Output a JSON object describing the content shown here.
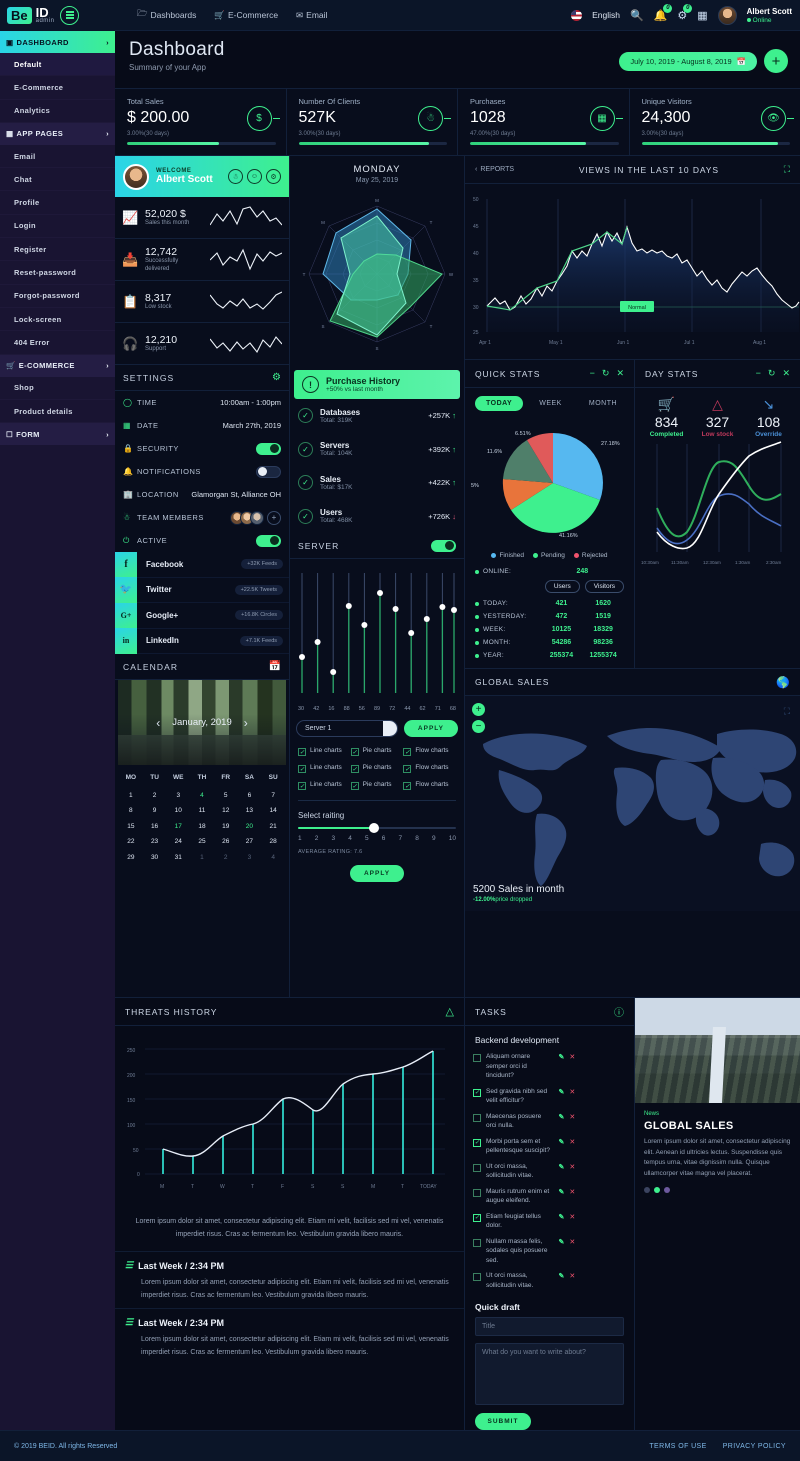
{
  "brand": {
    "logo_be": "Be",
    "logo_id": "ID",
    "logo_sub": "admin"
  },
  "topnav": [
    {
      "label": "Dashboards",
      "icon": "folder-icon"
    },
    {
      "label": "E-Commerce",
      "icon": "cart-icon"
    },
    {
      "label": "Email",
      "icon": "mail-icon"
    }
  ],
  "topright": {
    "language": "English",
    "search_icon": "search-icon",
    "bell_badge": "0",
    "alert_badge": "0",
    "grid_icon": "grid-icon",
    "user_name": "Albert Scott",
    "user_status": "Online"
  },
  "sidebar": {
    "groups": [
      {
        "label": "DASHBOARD",
        "icon": "dashboard-icon",
        "active": true,
        "items": [
          "Default",
          "E-Commerce",
          "Analytics"
        ]
      },
      {
        "label": "APP PAGES",
        "icon": "pages-icon",
        "active": false,
        "items": [
          "Email",
          "Chat",
          "Profile",
          "Login",
          "Register",
          "Reset-password",
          "Forgot-password",
          "Lock-screen",
          "404 Error"
        ]
      },
      {
        "label": "E-COMMERCE",
        "icon": "cart-icon",
        "active": false,
        "items": [
          "Shop",
          "Product details"
        ]
      },
      {
        "label": "FORM",
        "icon": "form-icon",
        "active": false,
        "items": []
      }
    ],
    "selected_item": "Default"
  },
  "page": {
    "title": "Dashboard",
    "subtitle": "Summary of your App",
    "date_range": "July 10, 2019 - August 8, 2019",
    "add_button": "+"
  },
  "kpis": [
    {
      "title": "Total Sales",
      "value": "$ 200.00",
      "change": "3.00%(30 days)",
      "progress": 62,
      "icon": "dollar-icon"
    },
    {
      "title": "Number Of Clients",
      "value": "527K",
      "change": "3.00%(30 days)",
      "progress": 88,
      "icon": "user-icon"
    },
    {
      "title": "Purchases",
      "value": "1028",
      "change": "47.00%(30 days)",
      "progress": 78,
      "icon": "calculator-icon"
    },
    {
      "title": "Unique Visitors",
      "value": "24,300",
      "change": "3.00%(30 days)",
      "progress": 92,
      "icon": "eye-icon"
    }
  ],
  "welcome": {
    "greeting": "WELCOME",
    "name": "Albert Scott",
    "icons": [
      "user-icon",
      "chat-icon",
      "gear-icon"
    ]
  },
  "mini_stats": [
    {
      "value": "52,020 $",
      "label": "Sales this month",
      "icon": "chart-bar-icon"
    },
    {
      "value": "12,742",
      "label": "Successfully delivered",
      "icon": "inbox-icon"
    },
    {
      "value": "8,317",
      "label": "Low stock",
      "icon": "clipboard-icon"
    },
    {
      "value": "12,210",
      "label": "Support",
      "icon": "headset-icon"
    }
  ],
  "settings": {
    "title": "SETTINGS",
    "gear_icon": "gear-icon",
    "rows": [
      {
        "label": "TIME",
        "value": "10:00am - 1:00pm",
        "icon": "clock-icon",
        "type": "text"
      },
      {
        "label": "DATE",
        "value": "March 27th, 2019",
        "icon": "calendar-icon",
        "type": "text"
      },
      {
        "label": "SECURITY",
        "value": "on",
        "icon": "lock-icon",
        "type": "toggle"
      },
      {
        "label": "NOTIFICATIONS",
        "value": "off",
        "icon": "bell-icon",
        "type": "toggle"
      },
      {
        "label": "LOCATION",
        "value": "Glamorgan St, Alliance OH",
        "icon": "building-icon",
        "type": "text"
      },
      {
        "label": "TEAM MEMBERS",
        "value": "",
        "icon": "team-icon",
        "type": "avatars"
      },
      {
        "label": "ACTIVE",
        "value": "on",
        "icon": "power-icon",
        "type": "toggle"
      }
    ]
  },
  "social": [
    {
      "name": "Facebook",
      "glyph": "f",
      "meta": "+32K Feeds"
    },
    {
      "name": "Twitter",
      "glyph": "t",
      "meta": "+22.5K Tweets"
    },
    {
      "name": "Google+",
      "glyph": "G+",
      "meta": "+16.8K Circles"
    },
    {
      "name": "LinkedIn",
      "glyph": "in",
      "meta": "+7.1K Feeds"
    }
  ],
  "calendar": {
    "title": "CALENDAR",
    "icon": "calendar-icon",
    "month": "January, 2019",
    "prev": "‹",
    "next": "›",
    "weekdays": [
      "MO",
      "TU",
      "WE",
      "TH",
      "FR",
      "SA",
      "SU"
    ],
    "days": [
      {
        "d": "1"
      },
      {
        "d": "2"
      },
      {
        "d": "3"
      },
      {
        "d": "4",
        "mark": true
      },
      {
        "d": "5"
      },
      {
        "d": "6"
      },
      {
        "d": "7"
      },
      {
        "d": "8"
      },
      {
        "d": "9"
      },
      {
        "d": "10"
      },
      {
        "d": "11"
      },
      {
        "d": "12"
      },
      {
        "d": "13"
      },
      {
        "d": "14"
      },
      {
        "d": "15"
      },
      {
        "d": "16"
      },
      {
        "d": "17",
        "mark": true
      },
      {
        "d": "18"
      },
      {
        "d": "19"
      },
      {
        "d": "20",
        "mark": true
      },
      {
        "d": "21"
      },
      {
        "d": "22"
      },
      {
        "d": "23"
      },
      {
        "d": "24"
      },
      {
        "d": "25"
      },
      {
        "d": "26"
      },
      {
        "d": "27"
      },
      {
        "d": "28"
      },
      {
        "d": "29"
      },
      {
        "d": "30"
      },
      {
        "d": "31"
      },
      {
        "d": "1",
        "mut": true
      },
      {
        "d": "2",
        "mut": true
      },
      {
        "d": "3",
        "mut": true
      },
      {
        "d": "4",
        "mut": true
      }
    ]
  },
  "radar": {
    "day": "MONDAY",
    "date": "May 25, 2019",
    "axes": [
      "M",
      "T",
      "W",
      "T",
      "F",
      "S",
      "S",
      "M"
    ],
    "series": [
      {
        "name": "series-blue",
        "color": "#2e7fb8",
        "values": [
          0.95,
          0.72,
          0.45,
          0.62,
          0.38,
          0.55,
          0.8,
          0.85
        ]
      },
      {
        "name": "series-green",
        "color": "#2f9e5e",
        "values": [
          0.3,
          0.4,
          0.95,
          0.7,
          0.92,
          0.5,
          0.35,
          0.28
        ]
      },
      {
        "name": "series-teal",
        "color": "#4fe3b0",
        "values": [
          0.85,
          0.55,
          0.3,
          0.6,
          0.9,
          0.85,
          0.4,
          0.75
        ]
      }
    ]
  },
  "purchase_history": {
    "title": "Purchase History",
    "subtitle": "+50% vs last month",
    "icon": "alert-icon",
    "rows": [
      {
        "name": "Databases",
        "total": "Total: 319K",
        "delta": "+257K",
        "dir": "up"
      },
      {
        "name": "Servers",
        "total": "Total: 104K",
        "delta": "+392K",
        "dir": "up"
      },
      {
        "name": "Sales",
        "total": "Total: $17K",
        "delta": "+422K",
        "dir": "up"
      },
      {
        "name": "Users",
        "total": "Total: 468K",
        "delta": "+726K",
        "dir": "down"
      }
    ]
  },
  "server": {
    "title": "SERVER",
    "toggle": "on",
    "values": [
      30,
      42,
      16,
      88,
      56,
      89,
      72,
      44,
      62,
      71,
      68
    ],
    "select_value": "Server 1",
    "apply_label": "APPLY",
    "checkboxes": [
      "Line charts",
      "Pie charts",
      "Flow charts",
      "Line charts",
      "Pie charts",
      "Flow charts",
      "Line charts",
      "Pie charts",
      "Flow charts"
    ],
    "rating_label": "Select raiting",
    "rating_scale": [
      "1",
      "2",
      "3",
      "4",
      "5",
      "6",
      "7",
      "8",
      "9",
      "10"
    ],
    "rating_value": 5,
    "average_label": "AVERAGE RATING: 7.6",
    "apply2_label": "APPLY"
  },
  "views_panel": {
    "reports_label": "REPORTS",
    "title": "VIEWS IN THE LAST 10 DAYS",
    "expand_icon": "expand-icon"
  },
  "quick_stats": {
    "title": "QUICK STATS",
    "controls": [
      "minimize-icon",
      "refresh-icon",
      "close-icon"
    ],
    "tabs": [
      "TODAY",
      "WEEK",
      "MONTH"
    ],
    "active_tab": "TODAY",
    "labels": {
      "l1": "6.51%",
      "l2": "27.18%",
      "l3": "11.6%",
      "l4": "5%",
      "l5": "41.16%"
    },
    "legend": [
      {
        "name": "Finished",
        "color": "#56b8f0"
      },
      {
        "name": "Pending",
        "color": "#3ef08e"
      },
      {
        "name": "Rejected",
        "color": "#f0536d"
      }
    ],
    "online_label": "ONLINE:",
    "online_value": "248",
    "col_users": "Users",
    "col_visitors": "Visitors",
    "rows": [
      {
        "label": "TODAY:",
        "users": "421",
        "visitors": "1620"
      },
      {
        "label": "YESTERDAY:",
        "users": "472",
        "visitors": "1519"
      },
      {
        "label": "WEEK:",
        "users": "10125",
        "visitors": "18329"
      },
      {
        "label": "MONTH:",
        "users": "54286",
        "visitors": "98236"
      },
      {
        "label": "YEAR:",
        "users": "255374",
        "visitors": "1255374"
      }
    ]
  },
  "day_stats": {
    "title": "DAY STATS",
    "controls": [
      "minimize-icon",
      "refresh-icon",
      "close-icon"
    ],
    "cards": [
      {
        "value": "834",
        "label": "Completed",
        "icon": "basket-icon",
        "color": "#3ef08e"
      },
      {
        "value": "327",
        "label": "Low stock",
        "icon": "warning-icon",
        "color": "#c0395c"
      },
      {
        "value": "108",
        "label": "Override",
        "icon": "arrow-down-icon",
        "color": "#4a8fd6"
      }
    ],
    "xlabels": [
      "10:30am",
      "11:30am",
      "12:30am",
      "1:30am",
      "2:30am"
    ]
  },
  "global_sales": {
    "title": "GLOBAL SALES",
    "globe_icon": "globe-icon",
    "zoom_in": "+",
    "zoom_out": "−",
    "expand_icon": "expand-icon",
    "summary": "5200 Sales in month",
    "delta": "-12.00%",
    "delta_note": "price dropped"
  },
  "threats": {
    "title": "THREATS HISTORY",
    "icon": "warning-icon",
    "note": "Lorem ipsum dolor sit amet, consectetur adipiscing elit. Etiam mi velit, facilisis sed mi vel, venenatis imperdiet risus. Cras ac fermentum leo. Vestibulum gravida libero mauris.",
    "entries": [
      {
        "title": "Last Week / 2:34 PM",
        "body": "Lorem ipsum dolor sit amet, consectetur adipiscing elit. Etiam mi velit, facilisis sed mi vel, venenatis imperdiet risus. Cras ac fermentum leo. Vestibulum gravida libero mauris."
      },
      {
        "title": "Last Week / 2:34 PM",
        "body": "Lorem ipsum dolor sit amet, consectetur adipiscing elit. Etiam mi velit, facilisis sed mi vel, venenatis imperdiet risus. Cras ac fermentum leo. Vestibulum gravida libero mauris."
      }
    ]
  },
  "tasks": {
    "title": "TASKS",
    "help_icon": "help-icon",
    "group": "Backend development",
    "items": [
      {
        "text": "Aliquam ornare semper orci id tincidunt?",
        "done": false
      },
      {
        "text": "Sed gravida nibh sed velit efficitur?",
        "done": true
      },
      {
        "text": "Maecenas posuere orci nulla.",
        "done": false
      },
      {
        "text": "Morbi porta sem et pellentesque suscipit?",
        "done": true
      },
      {
        "text": "Ut orci massa, sollicitudin vitae.",
        "done": false
      },
      {
        "text": "Mauris rutrum enim et augue eleifend.",
        "done": false
      },
      {
        "text": "Etiam feugiat tellus dolor.",
        "done": true
      },
      {
        "text": "Nullam massa felis, sodales quis posuere sed.",
        "done": false
      },
      {
        "text": "Ut orci massa, sollicitudin vitae.",
        "done": false
      }
    ],
    "draft_title": "Quick draft",
    "draft_title_ph": "Title",
    "draft_body_ph": "What do you want to write about?",
    "submit_label": "SUBMIT"
  },
  "news": {
    "kicker": "News",
    "headline": "GLOBAL SALES",
    "body": "Lorem ipsum dolor sit amet, consectetur adipiscing elit. Aenean id ultricies lectus. Suspendisse quis tempus urna, vitae dignissim nulla. Quisque ullamcorper vitae magna vel placerat."
  },
  "footer": {
    "copyright": "© 2019 BEID. All rights Reserved",
    "links": [
      "TERMS OF USE",
      "PRIVACY POLICY"
    ]
  },
  "chart_data": [
    {
      "type": "area",
      "name": "views-last-10-days",
      "title": "VIEWS IN THE LAST 10 DAYS",
      "xlabel": "",
      "ylabel": "",
      "ylim": [
        25,
        50
      ],
      "yticks": [
        25,
        30,
        35,
        40,
        45,
        50
      ],
      "xticks": [
        "Apr 1",
        "May 1",
        "Jun 1",
        "Jul 1",
        "Aug 1"
      ],
      "annotation": "Normal",
      "annotation_y": 30,
      "grid": true,
      "series": [
        {
          "name": "views",
          "color": "#ffffff",
          "values": [
            31,
            32,
            33,
            31.5,
            32,
            30.8,
            31.2,
            33,
            31.6,
            32.4,
            34.5,
            33,
            35,
            34,
            36.5,
            38,
            40,
            43,
            41.5,
            43,
            42,
            44.5,
            46.5,
            44,
            47,
            45,
            46.8,
            44.5,
            48,
            45,
            43.5,
            44,
            43,
            44.2,
            43.5,
            44,
            43,
            42.5,
            43.5,
            41.8,
            42.6,
            40.5,
            39,
            40,
            38.2,
            37,
            38,
            36.5,
            35.5,
            37,
            38.5,
            40,
            39,
            40.5,
            41.2,
            39.5,
            38,
            37,
            36,
            34,
            33.5,
            32,
            31.5,
            31,
            30.5,
            30.8,
            31.5,
            30.2,
            29.8,
            30.4,
            29.5,
            29,
            28.6,
            29.2,
            28,
            27.5,
            26.8,
            28.5,
            30.5,
            31.8
          ]
        }
      ]
    },
    {
      "type": "pie",
      "name": "quick-stats-pie",
      "title": "QUICK STATS",
      "labels": [
        "Finished",
        "Pending",
        "Rejected",
        "Pending-alt",
        "Rejected-alt"
      ],
      "values": [
        27.18,
        41.16,
        5,
        11.6,
        6.51
      ],
      "colors": [
        "#56b8f0",
        "#3ef08e",
        "#e8743b",
        "#4f7f6a",
        "#e05a5a"
      ],
      "legend": [
        "Finished",
        "Pending",
        "Rejected"
      ],
      "legend_position": "bottom"
    },
    {
      "type": "line",
      "name": "day-stats-lines",
      "title": "DAY STATS",
      "x": [
        "10:30am",
        "11:30am",
        "12:30am",
        "1:30am",
        "2:30am"
      ],
      "ylim": [
        0,
        100
      ],
      "grid": true,
      "series": [
        {
          "name": "completed",
          "color": "#2fae5c",
          "values": [
            48,
            18,
            72,
            92,
            62
          ]
        },
        {
          "name": "override",
          "color": "#4a6fc4",
          "values": [
            28,
            8,
            40,
            60,
            22
          ]
        },
        {
          "name": "low-stock",
          "color": "#ffffff",
          "values": [
            22,
            2,
            42,
            78,
            100
          ]
        }
      ]
    },
    {
      "type": "bar",
      "name": "threats-history",
      "title": "THREATS HISTORY",
      "categories": [
        "M",
        "T",
        "W",
        "T",
        "F",
        "S",
        "S",
        "M",
        "T",
        "TODAY"
      ],
      "values": [
        50,
        35,
        75,
        100,
        150,
        128,
        180,
        200,
        215,
        248
      ],
      "ylim": [
        0,
        250
      ],
      "yticks": [
        0,
        50,
        100,
        150,
        200,
        250
      ],
      "grid": true,
      "line_overlay": {
        "name": "trend",
        "color": "#ffffff",
        "values": [
          50,
          35,
          75,
          100,
          150,
          128,
          180,
          200,
          215,
          248
        ]
      }
    },
    {
      "type": "line",
      "name": "server-sliders",
      "title": "SERVER",
      "categories": [
        "30",
        "42",
        "16",
        "88",
        "56",
        "89",
        "72",
        "44",
        "62",
        "71",
        "68"
      ],
      "values": [
        30,
        42,
        16,
        88,
        56,
        89,
        72,
        44,
        62,
        71,
        68
      ],
      "ylim": [
        0,
        100
      ]
    },
    {
      "type": "line",
      "name": "mini-sparklines",
      "series": [
        {
          "name": "sales-this-month",
          "values": [
            20,
            45,
            30,
            55,
            25,
            60,
            70,
            52,
            66,
            40,
            48,
            30
          ]
        },
        {
          "name": "successfully-delivered",
          "values": [
            40,
            58,
            30,
            50,
            44,
            72,
            18,
            60,
            40,
            66,
            55,
            62
          ]
        },
        {
          "name": "low-stock",
          "values": [
            62,
            38,
            26,
            44,
            30,
            52,
            26,
            36,
            22,
            42,
            60,
            70
          ]
        },
        {
          "name": "support",
          "values": [
            58,
            30,
            44,
            26,
            50,
            30,
            48,
            22,
            56,
            34,
            62,
            40
          ]
        }
      ]
    },
    {
      "type": "radar",
      "name": "monday-radar",
      "title": "MONDAY",
      "subtitle": "May 25, 2019",
      "axes": [
        "M",
        "T",
        "W",
        "T",
        "F",
        "S",
        "S",
        "M"
      ],
      "series": [
        {
          "name": "blue",
          "color": "#2e7fb8",
          "values": [
            0.95,
            0.72,
            0.45,
            0.62,
            0.38,
            0.55,
            0.8,
            0.85
          ]
        },
        {
          "name": "green",
          "color": "#2f9e5e",
          "values": [
            0.3,
            0.4,
            0.95,
            0.7,
            0.92,
            0.5,
            0.35,
            0.28
          ]
        },
        {
          "name": "teal",
          "color": "#4fe3b0",
          "values": [
            0.85,
            0.55,
            0.3,
            0.6,
            0.9,
            0.85,
            0.4,
            0.75
          ]
        }
      ]
    }
  ]
}
